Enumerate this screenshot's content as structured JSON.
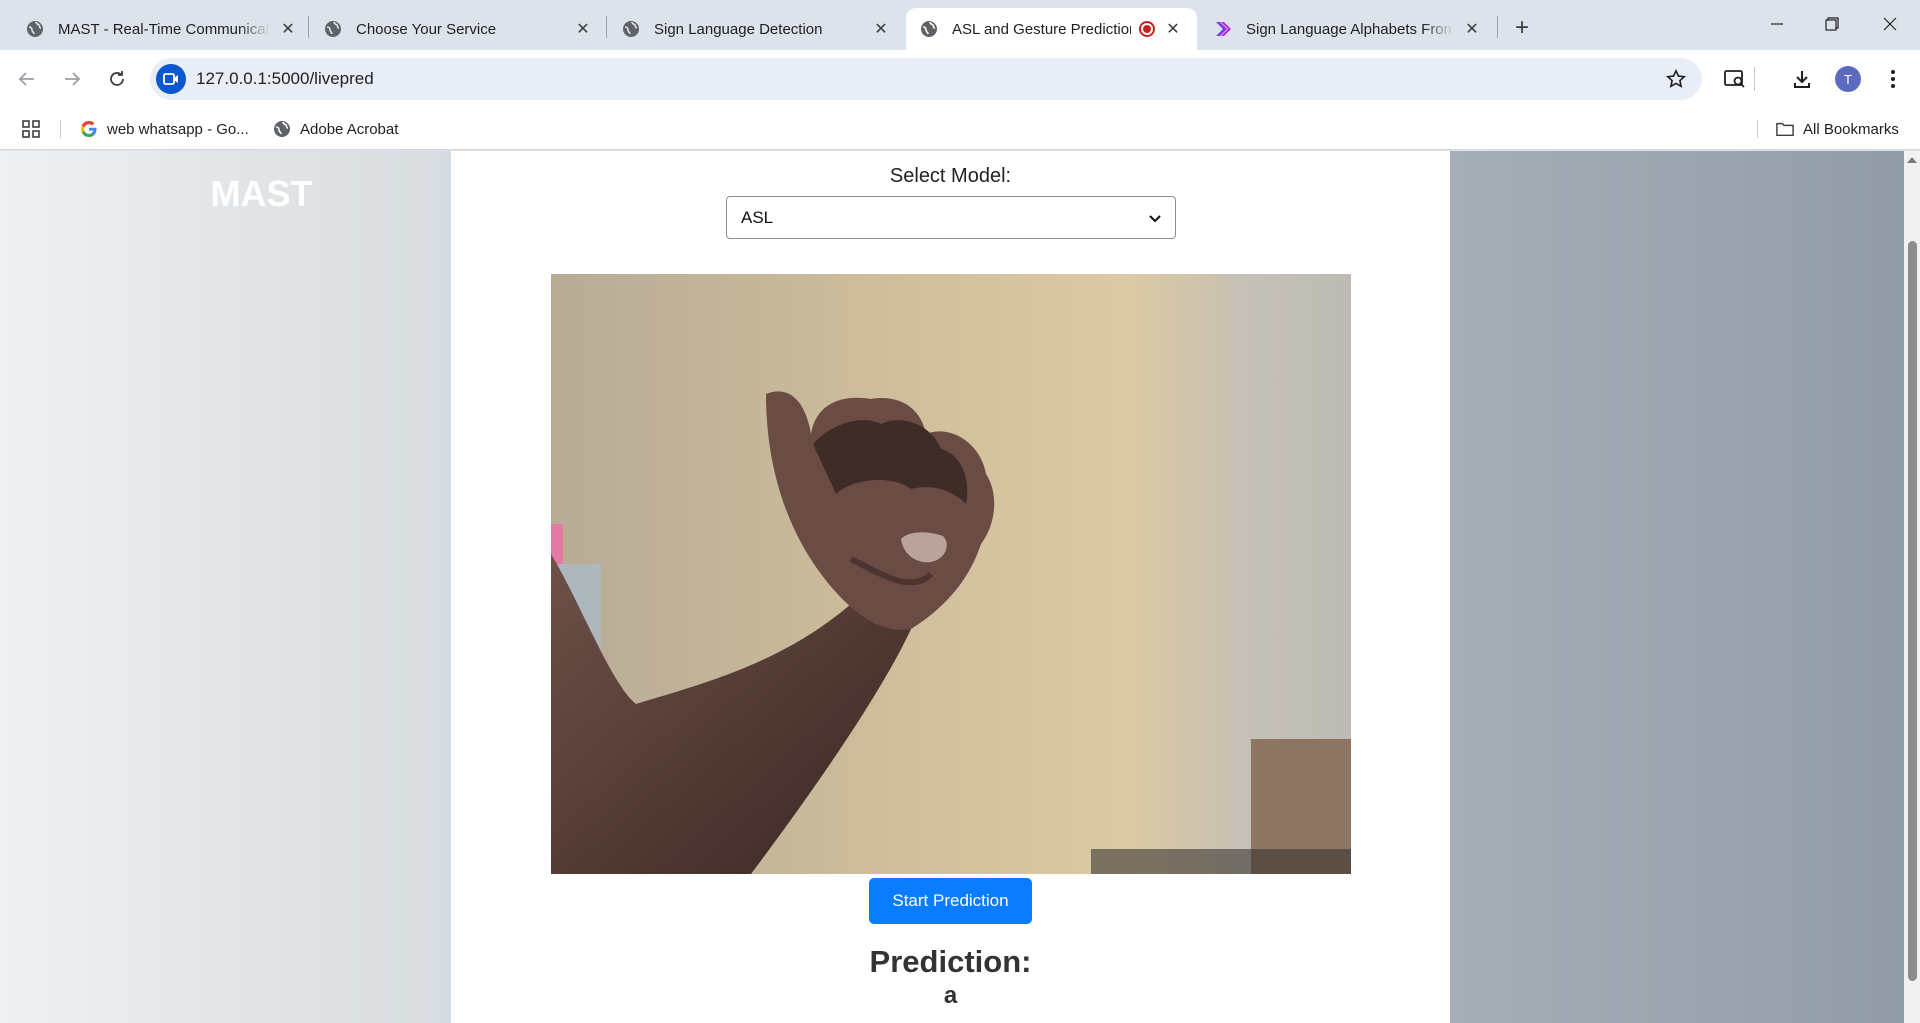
{
  "browser": {
    "tabs": [
      {
        "title": "MAST - Real-Time Communicat",
        "favicon": "globe-icon",
        "active": false
      },
      {
        "title": "Choose Your Service",
        "favicon": "globe-icon",
        "active": false
      },
      {
        "title": "Sign Language Detection",
        "favicon": "globe-icon",
        "active": false
      },
      {
        "title": "ASL and Gesture Prediction",
        "favicon": "globe-icon",
        "active": true,
        "recording": true
      },
      {
        "title": "Sign Language Alphabets From",
        "favicon": "purple-chevron-icon",
        "active": false
      }
    ],
    "url": "127.0.0.1:5000/livepred",
    "profile_initial": "T",
    "bookmarks": [
      {
        "label": "web whatsapp - Go...",
        "icon": "google-icon"
      },
      {
        "label": "Adobe Acrobat",
        "icon": "globe-icon"
      }
    ],
    "all_bookmarks_label": "All Bookmarks",
    "accent_color": "#0b57d0"
  },
  "page": {
    "brand": "MAST",
    "select_label": "Select Model:",
    "selected_model": "ASL",
    "start_button_label": "Start Prediction",
    "prediction_title": "Prediction:",
    "prediction_value": "a",
    "button_color": "#0a7cff"
  }
}
